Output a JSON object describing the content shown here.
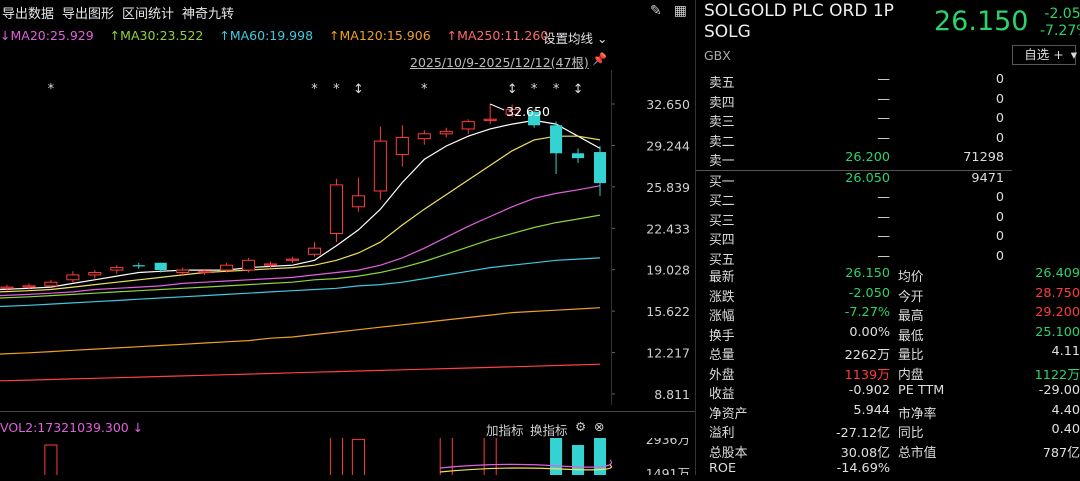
{
  "menu": [
    "导出数据",
    "导出图形",
    "区间统计",
    "神奇九转"
  ],
  "toolbar_icons": [
    "pen-icon",
    "grid-icon"
  ],
  "ma_legend": [
    {
      "label": "MA20:25.929",
      "color": "#e060e0"
    },
    {
      "label": "MA30:23.522",
      "color": "#8fd33b"
    },
    {
      "label": "MA60:19.998",
      "color": "#40c8e0"
    },
    {
      "label": "MA120:15.906",
      "color": "#f0a020"
    },
    {
      "label": "MA250:11.260",
      "color": "#ff6a6a"
    }
  ],
  "ma_settings": "设置均线",
  "range_text": "2025/10/9-2025/12/12(47根)",
  "y_ticks": [
    "32.650",
    "29.244",
    "25.839",
    "22.433",
    "19.028",
    "15.622",
    "12.217",
    "8.811"
  ],
  "high_marker": "32.650",
  "vol": {
    "label": "VOL2:17321039.300",
    "add_indicator": "加指标",
    "switch_indicator": "换指标",
    "ticks": [
      "2936万",
      "1491万"
    ]
  },
  "stock": {
    "name": "SOLGOLD PLC ORD 1P SOLG",
    "currency": "GBX",
    "price": "26.150",
    "change": "-2.050",
    "change_pct": "-7.27%",
    "watch_button": "自选 +"
  },
  "order_book": {
    "asks": [
      {
        "label": "卖五",
        "price": "—",
        "vol": "0"
      },
      {
        "label": "卖四",
        "price": "—",
        "vol": "0"
      },
      {
        "label": "卖三",
        "price": "—",
        "vol": "0"
      },
      {
        "label": "卖二",
        "price": "—",
        "vol": "0"
      },
      {
        "label": "卖一",
        "price": "26.200",
        "vol": "71298"
      }
    ],
    "bids": [
      {
        "label": "买一",
        "price": "26.050",
        "vol": "9471"
      },
      {
        "label": "买二",
        "price": "—",
        "vol": "0"
      },
      {
        "label": "买三",
        "price": "—",
        "vol": "0"
      },
      {
        "label": "买四",
        "price": "—",
        "vol": "0"
      },
      {
        "label": "买五",
        "price": "—",
        "vol": "0"
      }
    ]
  },
  "stats": [
    {
      "l1": "最新",
      "v1": "26.150",
      "c1": "green",
      "l2": "均价",
      "v2": "26.409",
      "c2": "green"
    },
    {
      "l1": "涨跌",
      "v1": "-2.050",
      "c1": "green",
      "l2": "今开",
      "v2": "28.750",
      "c2": "red"
    },
    {
      "l1": "涨幅",
      "v1": "-7.27%",
      "c1": "green",
      "l2": "最高",
      "v2": "29.200",
      "c2": "red"
    },
    {
      "l1": "换手",
      "v1": "0.00%",
      "c1": "white",
      "l2": "最低",
      "v2": "25.100",
      "c2": "green"
    },
    {
      "l1": "总量",
      "v1": "2262万",
      "c1": "white",
      "l2": "量比",
      "v2": "4.11",
      "c2": "white"
    },
    {
      "l1": "外盘",
      "v1": "1139万",
      "c1": "red",
      "l2": "内盘",
      "v2": "1122万",
      "c2": "green"
    },
    {
      "l1": "收益",
      "v1": "-0.902",
      "c1": "white",
      "l2": "PE TTM",
      "v2": "-29.00",
      "c2": "white"
    },
    {
      "l1": "净资产",
      "v1": "5.944",
      "c1": "white",
      "l2": "市净率",
      "v2": "4.40",
      "c2": "white"
    },
    {
      "l1": "溢利",
      "v1": "-27.12亿",
      "c1": "white",
      "l2": "同比",
      "v2": "0.40",
      "c2": "white"
    },
    {
      "l1": "总股本",
      "v1": "30.08亿",
      "c1": "white",
      "l2": "总市值",
      "v2": "787亿",
      "c2": "white"
    },
    {
      "l1": "ROE",
      "v1": "-14.69%",
      "c1": "white",
      "l2": "",
      "v2": "",
      "c2": "white"
    }
  ],
  "chart_data": {
    "type": "candlestick",
    "ylim": [
      8.811,
      32.65
    ],
    "candles": [
      {
        "o": 17.5,
        "h": 17.8,
        "l": 17.3,
        "c": 17.6,
        "up": true
      },
      {
        "o": 17.6,
        "h": 17.9,
        "l": 17.4,
        "c": 17.7,
        "up": true
      },
      {
        "o": 17.7,
        "h": 18.2,
        "l": 17.6,
        "c": 18.0,
        "up": true
      },
      {
        "o": 18.2,
        "h": 18.9,
        "l": 18.0,
        "c": 18.6,
        "up": true
      },
      {
        "o": 18.6,
        "h": 19.0,
        "l": 18.3,
        "c": 18.8,
        "up": true
      },
      {
        "o": 19.0,
        "h": 19.4,
        "l": 18.7,
        "c": 19.2,
        "up": true
      },
      {
        "o": 19.3,
        "h": 19.6,
        "l": 19.1,
        "c": 19.4,
        "up": false
      },
      {
        "o": 19.6,
        "h": 19.6,
        "l": 18.8,
        "c": 19.0,
        "up": false
      },
      {
        "o": 18.8,
        "h": 19.2,
        "l": 18.6,
        "c": 19.0,
        "up": true
      },
      {
        "o": 18.8,
        "h": 19.1,
        "l": 18.6,
        "c": 18.9,
        "up": true
      },
      {
        "o": 19.0,
        "h": 19.6,
        "l": 18.8,
        "c": 19.4,
        "up": true
      },
      {
        "o": 19.0,
        "h": 20.0,
        "l": 18.8,
        "c": 19.8,
        "up": true
      },
      {
        "o": 19.4,
        "h": 19.7,
        "l": 19.2,
        "c": 19.5,
        "up": true
      },
      {
        "o": 19.8,
        "h": 20.1,
        "l": 19.6,
        "c": 19.9,
        "up": true
      },
      {
        "o": 20.3,
        "h": 21.3,
        "l": 20.1,
        "c": 20.8,
        "up": true
      },
      {
        "o": 22.0,
        "h": 26.5,
        "l": 21.3,
        "c": 26.0,
        "up": true
      },
      {
        "o": 24.2,
        "h": 26.6,
        "l": 23.8,
        "c": 25.1,
        "up": true
      },
      {
        "o": 25.5,
        "h": 30.8,
        "l": 24.8,
        "c": 29.6,
        "up": true
      },
      {
        "o": 28.5,
        "h": 30.9,
        "l": 27.5,
        "c": 29.9,
        "up": true
      },
      {
        "o": 29.8,
        "h": 30.5,
        "l": 29.3,
        "c": 30.2,
        "up": true
      },
      {
        "o": 30.2,
        "h": 30.7,
        "l": 29.9,
        "c": 30.4,
        "up": true
      },
      {
        "o": 30.6,
        "h": 31.4,
        "l": 30.2,
        "c": 31.2,
        "up": true
      },
      {
        "o": 31.3,
        "h": 32.65,
        "l": 31.0,
        "c": 31.4,
        "up": true
      },
      {
        "o": 32.2,
        "h": 32.6,
        "l": 31.6,
        "c": 31.8,
        "up": true
      },
      {
        "o": 32.0,
        "h": 32.2,
        "l": 30.7,
        "c": 30.9,
        "up": false
      },
      {
        "o": 30.9,
        "h": 31.2,
        "l": 26.9,
        "c": 28.6,
        "up": false
      },
      {
        "o": 28.6,
        "h": 29.0,
        "l": 27.8,
        "c": 28.2,
        "up": false
      },
      {
        "o": 28.7,
        "h": 29.2,
        "l": 25.1,
        "c": 26.15,
        "up": false
      }
    ],
    "ma": [
      {
        "name": "MA5",
        "color": "#ffffff",
        "values": [
          17.4,
          17.5,
          17.6,
          17.9,
          18.2,
          18.5,
          18.8,
          18.9,
          19.0,
          19.0,
          19.0,
          19.2,
          19.3,
          19.4,
          19.8,
          21.0,
          22.3,
          24.0,
          26.2,
          28.1,
          29.2,
          30.0,
          30.6,
          31.0,
          31.3,
          31.0,
          30.0,
          29.0
        ]
      },
      {
        "name": "MA10",
        "color": "#f0e060",
        "values": [
          17.2,
          17.3,
          17.4,
          17.6,
          17.8,
          18.0,
          18.2,
          18.4,
          18.6,
          18.8,
          18.9,
          19.0,
          19.1,
          19.2,
          19.4,
          19.8,
          20.4,
          21.3,
          22.7,
          24.0,
          25.2,
          26.4,
          27.6,
          28.8,
          29.7,
          30.0,
          30.0,
          29.7
        ]
      },
      {
        "name": "MA20",
        "color": "#e060e0",
        "values": [
          16.9,
          17.0,
          17.1,
          17.2,
          17.4,
          17.5,
          17.6,
          17.7,
          17.9,
          18.0,
          18.1,
          18.2,
          18.3,
          18.4,
          18.6,
          18.8,
          19.0,
          19.4,
          20.0,
          20.8,
          21.7,
          22.6,
          23.4,
          24.2,
          24.9,
          25.3,
          25.6,
          25.93
        ]
      },
      {
        "name": "MA30",
        "color": "#8fd33b",
        "values": [
          16.7,
          16.8,
          16.9,
          17.0,
          17.1,
          17.2,
          17.3,
          17.4,
          17.5,
          17.6,
          17.7,
          17.8,
          17.9,
          18.0,
          18.2,
          18.3,
          18.5,
          18.8,
          19.2,
          19.7,
          20.3,
          20.9,
          21.5,
          22.0,
          22.5,
          22.9,
          23.2,
          23.52
        ]
      },
      {
        "name": "MA60",
        "color": "#40c8e0",
        "values": [
          16.0,
          16.1,
          16.2,
          16.3,
          16.4,
          16.5,
          16.6,
          16.7,
          16.8,
          16.9,
          17.0,
          17.1,
          17.2,
          17.3,
          17.4,
          17.5,
          17.7,
          17.8,
          18.0,
          18.3,
          18.6,
          18.9,
          19.2,
          19.4,
          19.6,
          19.8,
          19.9,
          20.0
        ]
      },
      {
        "name": "MA120",
        "color": "#f0a020",
        "values": [
          12.1,
          12.2,
          12.3,
          12.4,
          12.5,
          12.6,
          12.7,
          12.8,
          12.9,
          13.0,
          13.1,
          13.2,
          13.4,
          13.5,
          13.7,
          13.9,
          14.1,
          14.3,
          14.5,
          14.7,
          14.9,
          15.1,
          15.3,
          15.5,
          15.6,
          15.7,
          15.8,
          15.906
        ]
      },
      {
        "name": "MA250",
        "color": "#ff4040",
        "values": [
          9.9,
          9.95,
          10.0,
          10.05,
          10.1,
          10.15,
          10.2,
          10.25,
          10.3,
          10.35,
          10.4,
          10.45,
          10.5,
          10.55,
          10.6,
          10.65,
          10.7,
          10.75,
          10.8,
          10.85,
          10.9,
          10.95,
          11.0,
          11.05,
          11.1,
          11.15,
          11.2,
          11.26
        ]
      }
    ],
    "volume_ticks": [
      2936,
      1491
    ],
    "volumes": [
      {
        "v": 0,
        "up": true
      },
      {
        "v": 0,
        "up": true
      },
      {
        "v": 1600,
        "up": true
      },
      {
        "v": 0,
        "up": true
      },
      {
        "v": 0,
        "up": true
      },
      {
        "v": 0,
        "up": true
      },
      {
        "v": 0,
        "up": true
      },
      {
        "v": 0,
        "up": true
      },
      {
        "v": 0,
        "up": true
      },
      {
        "v": 0,
        "up": true
      },
      {
        "v": 0,
        "up": true
      },
      {
        "v": 0,
        "up": true
      },
      {
        "v": 0,
        "up": true
      },
      {
        "v": 0,
        "up": true
      },
      {
        "v": 0,
        "up": true
      },
      {
        "v": 2300,
        "up": true
      },
      {
        "v": 1900,
        "up": true
      },
      {
        "v": 0,
        "up": true
      },
      {
        "v": 0,
        "up": true
      },
      {
        "v": 0,
        "up": true
      },
      {
        "v": 2900,
        "up": true
      },
      {
        "v": 0,
        "up": true
      },
      {
        "v": 2000,
        "up": true
      },
      {
        "v": 0,
        "up": true
      },
      {
        "v": 0,
        "up": true
      },
      {
        "v": 2500,
        "up": false
      },
      {
        "v": 1600,
        "up": false
      },
      {
        "v": 2262,
        "up": false
      }
    ]
  }
}
